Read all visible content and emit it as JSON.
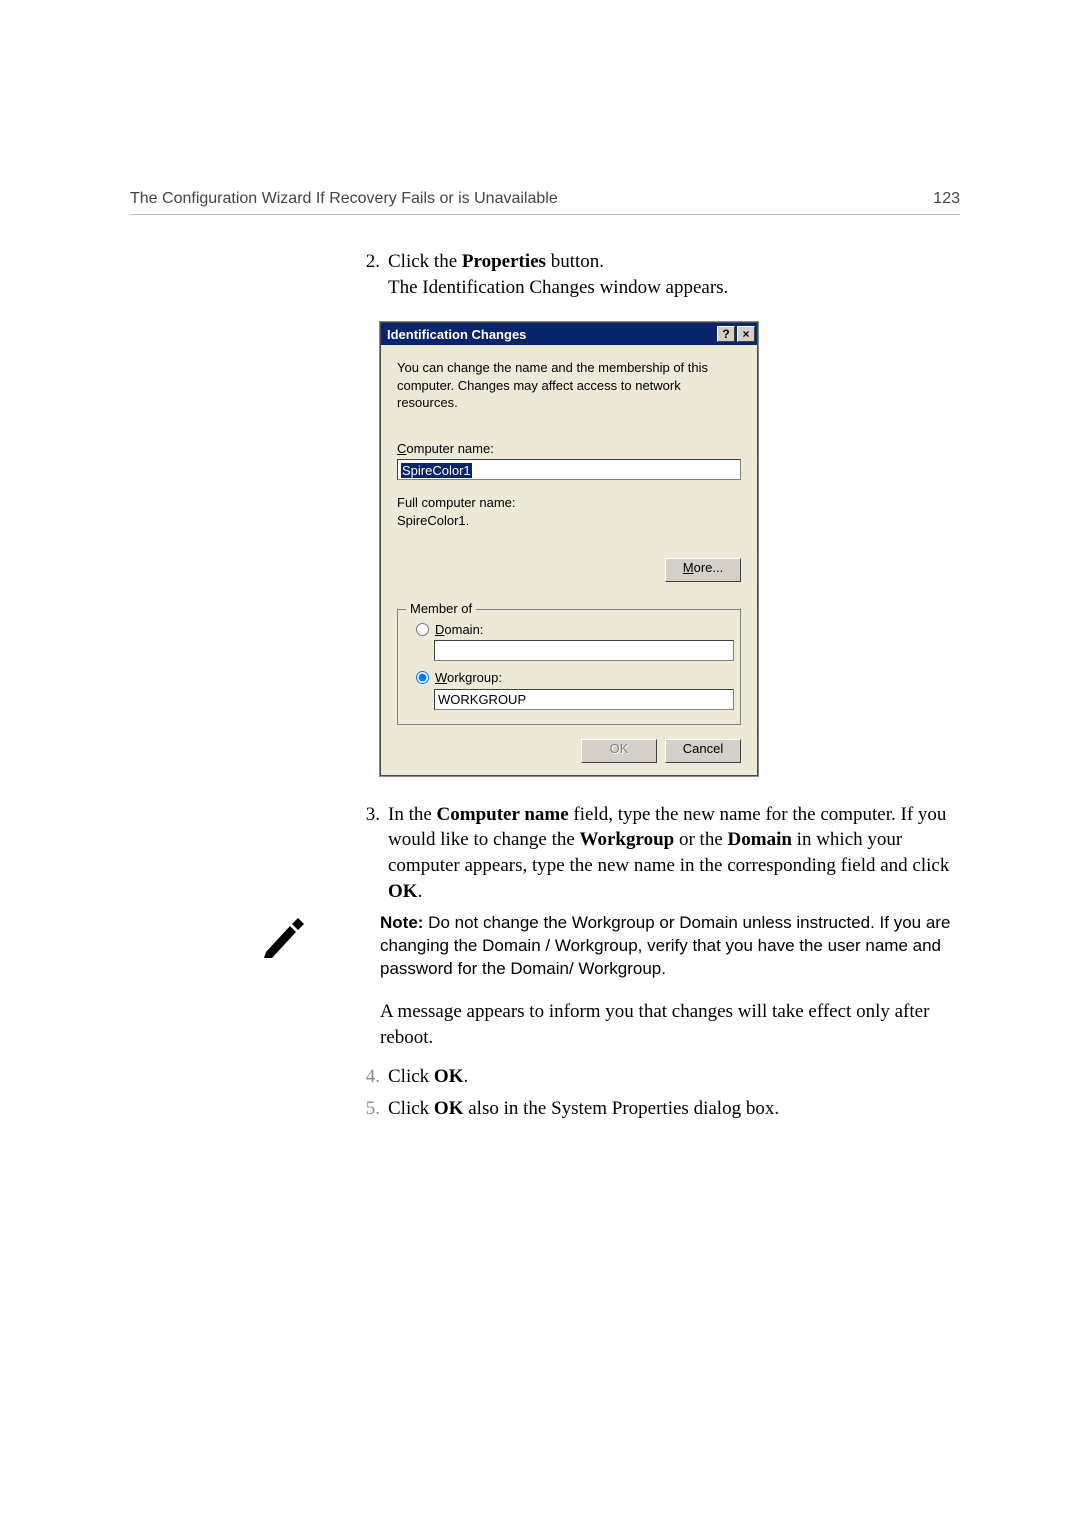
{
  "header": {
    "left": "The Configuration Wizard If Recovery Fails or is Unavailable",
    "right": "123"
  },
  "steps": {
    "s2": {
      "num": "2.",
      "text_a": "Click the ",
      "bold_a": "Properties",
      "text_b": " button.",
      "line2": "The Identification Changes window appears."
    },
    "s3": {
      "num": "3.",
      "text_a": "In the ",
      "bold_a": "Computer name",
      "text_b": " field, type the new name for the computer. If you would like to change the ",
      "bold_b": "Workgroup",
      "text_c": " or the ",
      "bold_c": "Domain",
      "text_d": " in which your computer appears, type the new name in the corresponding field and click ",
      "bold_d": "OK",
      "text_e": "."
    },
    "note": {
      "bold": "Note:  ",
      "text": "Do not change the Workgroup or Domain unless instructed. If you are changing the Domain / Workgroup, verify that you have the user name and password for the Domain/ Workgroup."
    },
    "post_note": "A message appears to inform you that changes will take effect only after reboot.",
    "s4": {
      "num": "4.",
      "text_a": "Click ",
      "bold_a": "OK",
      "text_b": "."
    },
    "s5": {
      "num": "5.",
      "text_a": "Click ",
      "bold_a": "OK",
      "text_b": " also in the System Properties dialog box."
    }
  },
  "dialog": {
    "title": "Identification Changes",
    "help": "?",
    "close": "×",
    "intro": "You can change the name and the membership of this computer. Changes may affect access to network resources.",
    "computer_name_label_c": "C",
    "computer_name_label_rest": "omputer name:",
    "computer_name_value": "SpireColor1",
    "full_label": "Full computer name:",
    "full_value": "SpireColor1.",
    "more_m": "M",
    "more_rest": "ore...",
    "member_of": "Member of",
    "domain_d": "D",
    "domain_rest": "omain:",
    "domain_value": "",
    "workgroup_w": "W",
    "workgroup_rest": "orkgroup:",
    "workgroup_value": "WORKGROUP",
    "ok": "OK",
    "cancel": "Cancel"
  }
}
